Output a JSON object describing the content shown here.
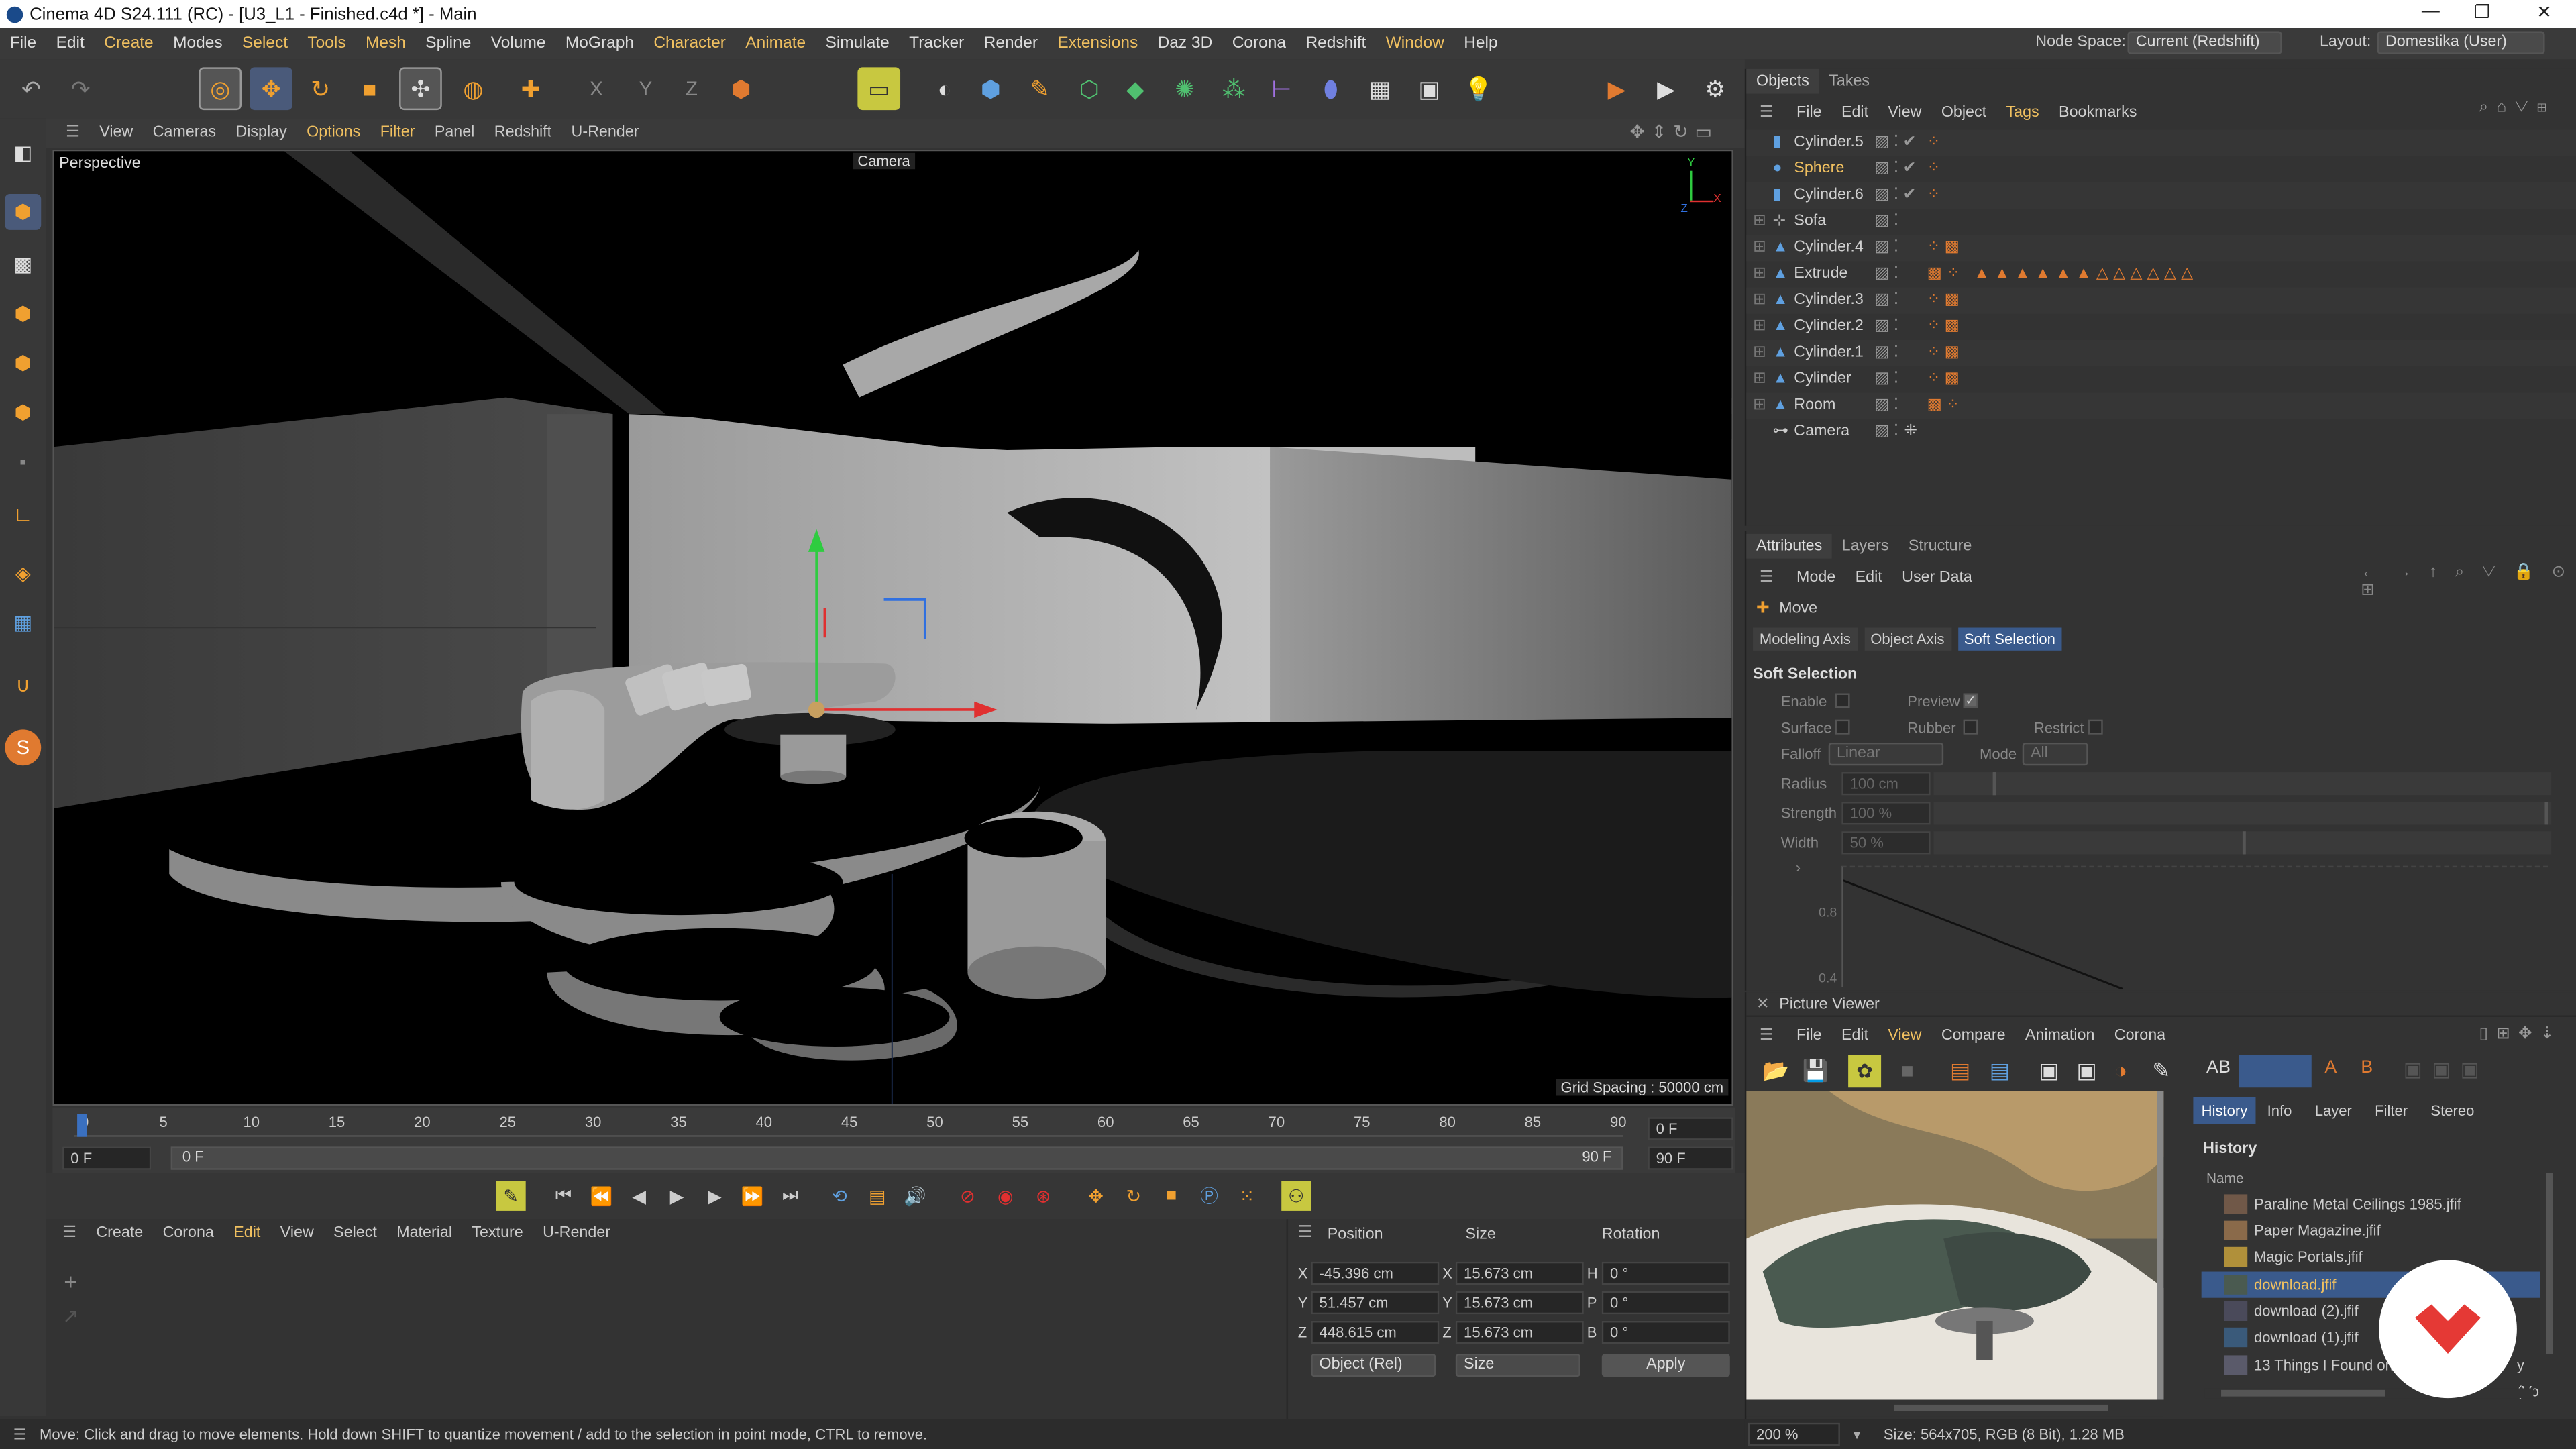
{
  "window": {
    "title": "Cinema 4D S24.111 (RC) - [U3_L1 - Finished.c4d *] - Main",
    "minimize": "—",
    "maximize": "❐",
    "close": "✕"
  },
  "menu": [
    "File",
    "Edit",
    "Create",
    "Modes",
    "Select",
    "Tools",
    "Mesh",
    "Spline",
    "Volume",
    "MoGraph",
    "Character",
    "Animate",
    "Simulate",
    "Tracker",
    "Render",
    "Extensions",
    "Daz 3D",
    "Corona",
    "Redshift",
    "Window",
    "Help"
  ],
  "node_space": {
    "label": "Node Space:",
    "value": "Current (Redshift)"
  },
  "layout": {
    "label": "Layout:",
    "value": "Domestika (User)"
  },
  "viewport_menu": [
    "View",
    "Cameras",
    "Display",
    "Options",
    "Filter",
    "Panel",
    "Redshift",
    "U-Render"
  ],
  "viewport": {
    "name": "Perspective",
    "camera": "Camera",
    "grid_spacing": "Grid Spacing : 50000 cm"
  },
  "timeline": {
    "ticks": [
      "0",
      "5",
      "10",
      "15",
      "20",
      "25",
      "30",
      "35",
      "40",
      "45",
      "50",
      "55",
      "60",
      "65",
      "70",
      "75",
      "80",
      "85",
      "90"
    ],
    "current_frame": "0 F",
    "start": "0 F",
    "range_start": "0 F",
    "range_end": "90 F",
    "end": "90 F"
  },
  "material_menu": [
    "Create",
    "Corona",
    "Edit",
    "View",
    "Select",
    "Material",
    "Texture",
    "U-Render"
  ],
  "coords": {
    "headers": {
      "position": "Position",
      "size": "Size",
      "rotation": "Rotation"
    },
    "rows": [
      {
        "axis": "X",
        "pos": "-45.396 cm",
        "saxis": "X",
        "size": "15.673 cm",
        "raxis": "H",
        "rot": "0 °"
      },
      {
        "axis": "Y",
        "pos": "51.457 cm",
        "saxis": "Y",
        "size": "15.673 cm",
        "raxis": "P",
        "rot": "0 °"
      },
      {
        "axis": "Z",
        "pos": "448.615 cm",
        "saxis": "Z",
        "size": "15.673 cm",
        "raxis": "B",
        "rot": "0 °"
      }
    ],
    "mode": "Object (Rel)",
    "size_mode": "Size",
    "apply": "Apply"
  },
  "status": "Move: Click and drag to move elements. Hold down SHIFT to quantize movement / add to the selection in point mode, CTRL to remove.",
  "objects_panel": {
    "tabs": [
      "Objects",
      "Takes"
    ],
    "menu": [
      "File",
      "Edit",
      "View",
      "Object",
      "Tags",
      "Bookmarks"
    ],
    "items": [
      "Cylinder.5",
      "Sphere",
      "Cylinder.6",
      "Sofa",
      "Cylinder.4",
      "Extrude",
      "Cylinder.3",
      "Cylinder.2",
      "Cylinder.1",
      "Cylinder",
      "Room",
      "Camera"
    ]
  },
  "attributes": {
    "tabs": [
      "Attributes",
      "Layers",
      "Structure"
    ],
    "menu": [
      "Mode",
      "Edit",
      "User Data"
    ],
    "tool": "Move",
    "subtabs": [
      "Modeling Axis",
      "Object Axis",
      "Soft Selection"
    ],
    "section": "Soft Selection",
    "enable": "Enable",
    "preview": "Preview",
    "surface": "Surface",
    "rubber": "Rubber",
    "restrict": "Restrict",
    "falloff": "Falloff",
    "falloff_value": "Linear",
    "mode": "Mode",
    "mode_value": "All",
    "radius": "Radius",
    "radius_value": "100 cm",
    "strength": "Strength",
    "strength_value": "100 %",
    "width": "Width",
    "width_value": "50 %",
    "graph_y1": "0.8",
    "graph_y2": "0.4"
  },
  "picture_viewer": {
    "title": "Picture Viewer",
    "menu": [
      "File",
      "Edit",
      "View",
      "Compare",
      "Animation",
      "Corona"
    ],
    "side_tabs": [
      "History",
      "Info",
      "Layer",
      "Filter",
      "Stereo"
    ],
    "history_title": "History",
    "name_header": "Name",
    "history": [
      "Paraline Metal Ceilings 1985.jfif",
      "Paper Magazine.jfif",
      "Magic Portals.jfif",
      "download.jfif",
      "download (2).jfif",
      "download (1).jfif",
      "13 Things I Found on"
    ],
    "history_tail": "y (Vo",
    "zoom": "200 %",
    "size_info": "Size: 564x705, RGB (8 Bit), 1.28 MB"
  },
  "colors": {
    "accent": "#f0c060",
    "selection": "#3a5a8c",
    "orange": "#e07a30",
    "brand": "#e53935"
  }
}
